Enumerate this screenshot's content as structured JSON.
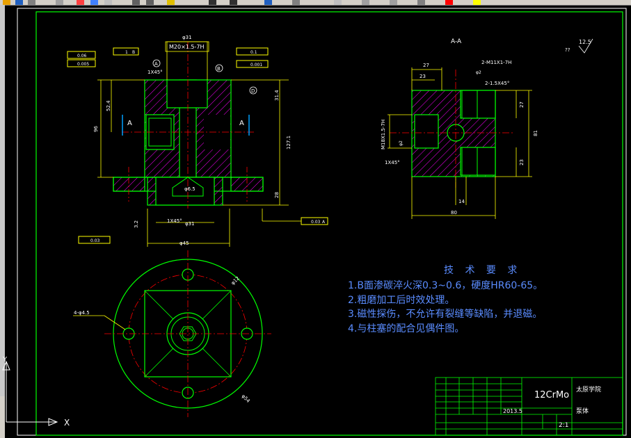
{
  "section_label": "A-A",
  "surface_roughness": "12.5",
  "roughness_note": "??",
  "tech_requirements": {
    "title": "技 术 要 求",
    "items": [
      "1.B面渗碳淬火深0.3~0.6，硬度HR60-65。",
      "2.粗磨加工后时效处理。",
      "3.磁性探伤，不允许有裂缝等缺陷，并退磁。",
      "4.与柱塞的配合见偶件图。"
    ]
  },
  "title_block": {
    "material": "12CrMo",
    "school": "太原学院",
    "scale": "2:1",
    "date": "2013.5",
    "drawing_name": "泵体"
  },
  "dimensions": {
    "top_width": "φ31",
    "thread": "M20×1.5-7H",
    "chamfer_top": "1X45°",
    "chamfer_bottom": "1X45°",
    "bottom_dia": "φ31",
    "flange_dia": "φ45",
    "height_total": "96",
    "height_upper": "52.4",
    "height_right": "31.4",
    "height_right_total": "127.1",
    "side_dim": "28",
    "hole_dia": "φ6.5",
    "bolt_holes": "4-φ4.5",
    "ref_dim": "3.2",
    "pcd": "φ12",
    "outer": "φ54",
    "sec_27": "27",
    "sec_23": "23",
    "sec_thread": "2-M11X1-7H",
    "sec_chamfer": "2-1.5X45°",
    "sec_m18": "M18X1.5-7H",
    "sec_81": "81",
    "sec_27b": "27",
    "sec_23b": "23",
    "sec_14": "14",
    "sec_80": "80",
    "sec_chamfer2": "1X45°",
    "sec_phi2": "φ2",
    "sec_phi2b": "φ2"
  },
  "tolerances": {
    "perp": "0.06",
    "para": "0.005",
    "datum": "1",
    "datum_b": "B",
    "circ1": "0.1",
    "circ2": "0.001",
    "flat": "0.03",
    "pos": "0.03",
    "pos_datum": "A"
  },
  "datum_labels": [
    "A",
    "B",
    "D"
  ],
  "ucs": {
    "x": "X",
    "y": "Y"
  },
  "colors": {
    "outline": "#00ff00",
    "hatch": "#ff00ff",
    "dimension": "#ffff00",
    "center": "#ff0000",
    "text": "#ffffff",
    "tech": "#5a8cff"
  }
}
